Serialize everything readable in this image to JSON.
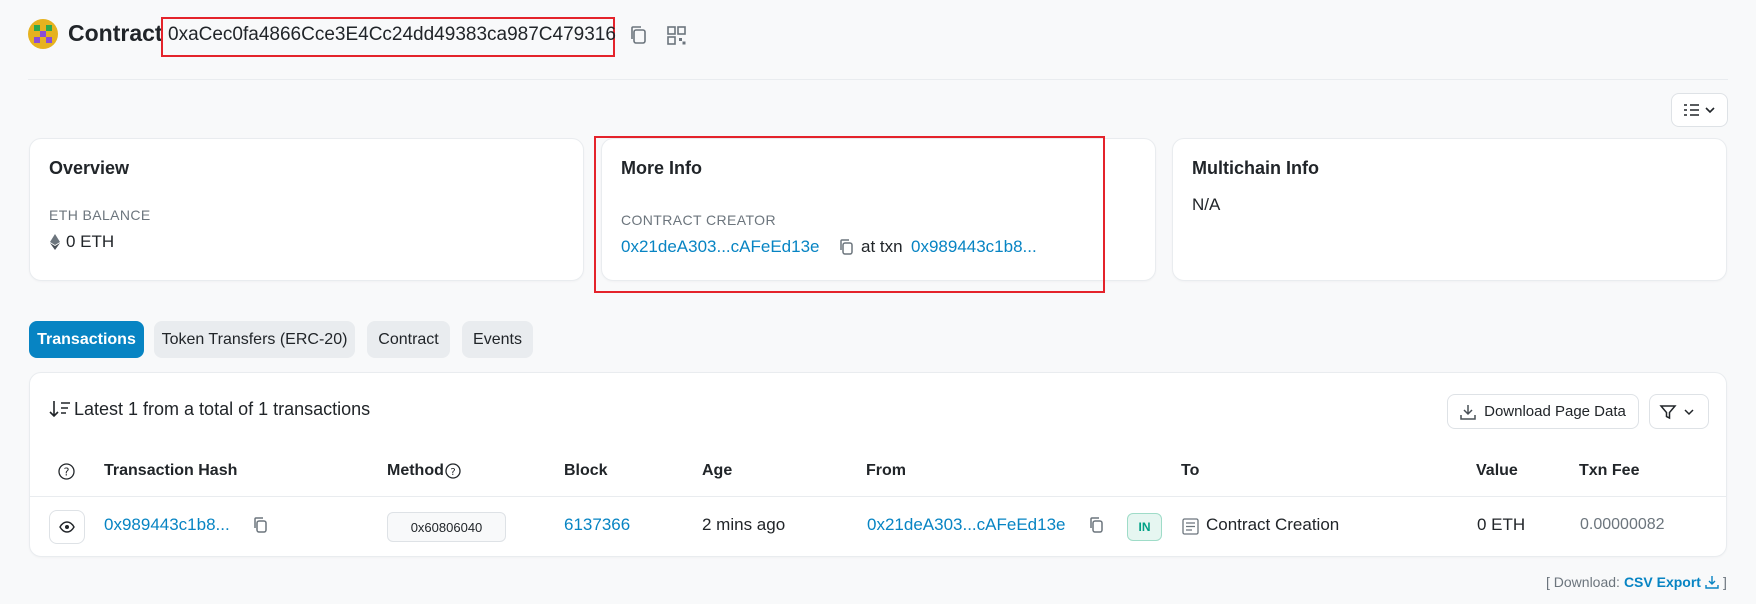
{
  "header": {
    "label": "Contract",
    "address": "0xaCec0fa4866Cce3E4Cc24dd49383ca987C479316"
  },
  "overview": {
    "title": "Overview",
    "eth_balance_label": "ETH BALANCE",
    "eth_balance_value": "0 ETH"
  },
  "more_info": {
    "title": "More Info",
    "creator_label": "CONTRACT CREATOR",
    "creator_address": "0x21deA303...cAFeEd13e",
    "at_txn_label": "at txn",
    "txn_hash": "0x989443c1b8..."
  },
  "multichain": {
    "title": "Multichain Info",
    "value": "N/A"
  },
  "tabs": [
    {
      "label": "Transactions",
      "active": true
    },
    {
      "label": "Token Transfers (ERC-20)",
      "active": false
    },
    {
      "label": "Contract",
      "active": false
    },
    {
      "label": "Events",
      "active": false
    }
  ],
  "transactions": {
    "summary": "Latest 1 from a total of 1 transactions",
    "download_button": "Download Page Data",
    "columns": [
      "Transaction Hash",
      "Method",
      "Block",
      "Age",
      "From",
      "To",
      "Value",
      "Txn Fee"
    ],
    "rows": [
      {
        "hash": "0x989443c1b8...",
        "method": "0x60806040",
        "block": "6137366",
        "age": "2 mins ago",
        "from": "0x21deA303...cAFeEd13e",
        "direction": "IN",
        "to": "Contract Creation",
        "value": "0 ETH",
        "fee": "0.00000082"
      }
    ]
  },
  "footer": {
    "open_bracket": "[ Download:",
    "csv_link": "CSV Export",
    "close_bracket": "]"
  },
  "colors": {
    "accent": "#0784c3",
    "highlight_border": "#e4232b",
    "in_badge": "#00a186"
  }
}
